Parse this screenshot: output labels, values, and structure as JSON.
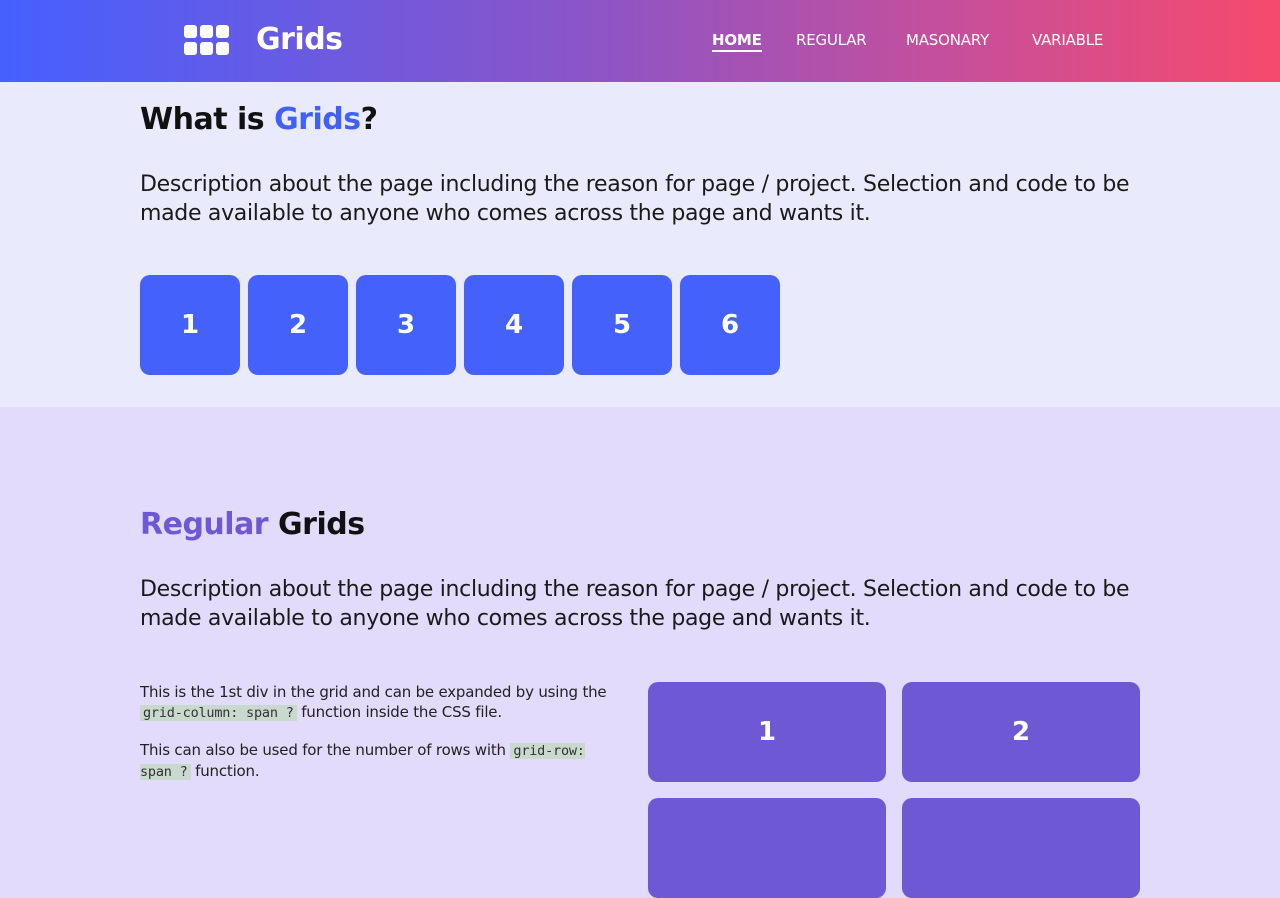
{
  "header": {
    "brand": "Grids",
    "logo_icon": "grid-dots-icon",
    "nav": [
      {
        "label": "HOME",
        "active": true
      },
      {
        "label": "REGULAR",
        "active": false
      },
      {
        "label": "MASONARY",
        "active": false
      },
      {
        "label": "VARIABLE",
        "active": false
      }
    ]
  },
  "intro": {
    "title_prefix": "What is ",
    "title_highlight": "Grids",
    "title_suffix": "?",
    "description": "Description about the page including the reason for page / project. Selection and code to be made available to anyone who comes across the page and wants it.",
    "boxes": [
      "1",
      "2",
      "3",
      "4",
      "5",
      "6"
    ]
  },
  "regular": {
    "title_highlight": "Regular",
    "title_suffix": " Grids",
    "description": "Description about the page including the reason for page / project. Selection and code to be made available to anyone who comes across the page and wants it.",
    "note1_a": "This is the 1st div in the grid and can be expanded by using the ",
    "note1_code": "grid-column: span ?",
    "note1_b": " function inside the CSS file.",
    "note2_a": "This can also be used for the number of rows with ",
    "note2_code": "grid-row: span ?",
    "note2_b": " function.",
    "boxes": [
      "1",
      "2"
    ]
  },
  "colors": {
    "header_gradient_start": "#4560ff",
    "header_gradient_end": "#f64a6c",
    "accent_blue": "#4462fb",
    "accent_purple": "#6e58d3"
  }
}
